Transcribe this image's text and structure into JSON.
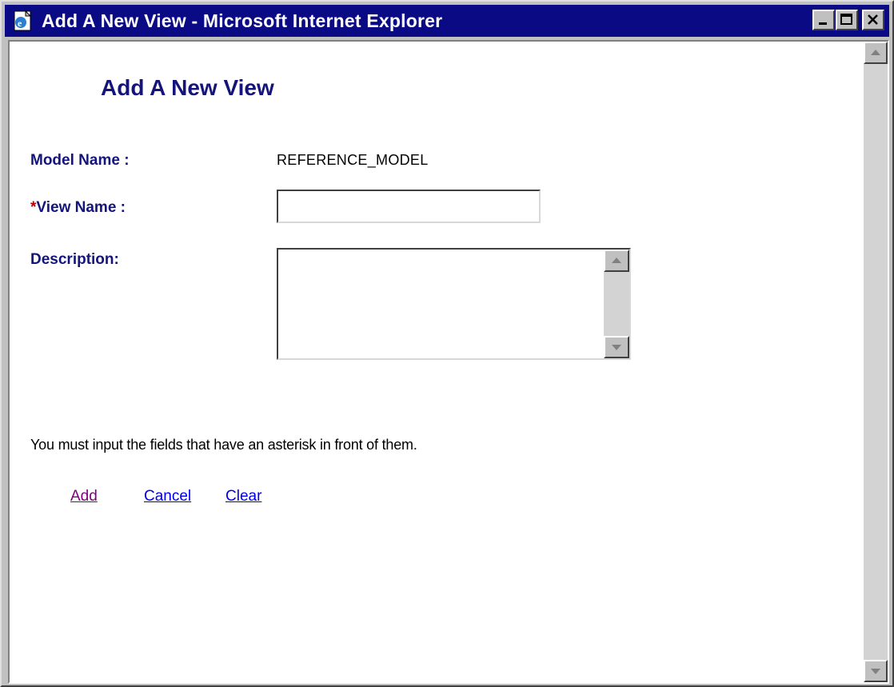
{
  "window": {
    "title": "Add A New View - Microsoft Internet Explorer",
    "icon": "ie-page-icon",
    "controls": [
      "minimize-icon",
      "maximize-icon",
      "close-icon"
    ]
  },
  "page": {
    "heading": "Add A New View"
  },
  "form": {
    "model_name": {
      "label": "Model Name :",
      "value": "REFERENCE_MODEL"
    },
    "view_name": {
      "required_marker": "*",
      "label": "View Name :",
      "value": ""
    },
    "description": {
      "label": "Description:",
      "value": ""
    }
  },
  "note": "You must input the fields that have an asterisk in front of them.",
  "actions": {
    "add": "Add",
    "cancel": "Cancel",
    "clear": "Clear"
  },
  "colors": {
    "titlebar": "#0a0a84",
    "label": "#14147a",
    "required": "#b20000",
    "link": "#0000ee",
    "visited_link": "#800080"
  }
}
